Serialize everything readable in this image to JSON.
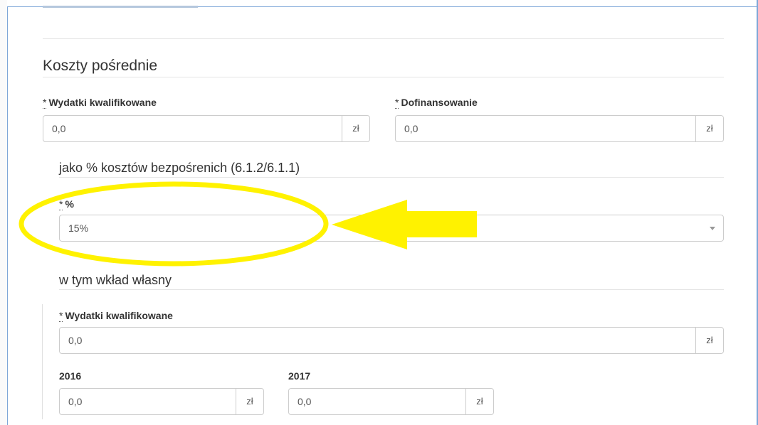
{
  "section": {
    "title": "Koszty pośrednie"
  },
  "required_marker": "*",
  "currency_unit": "zł",
  "eligible_costs": {
    "label": "Wydatki kwalifikowane",
    "value": "0,0"
  },
  "cofinancing": {
    "label": "Dofinansowanie",
    "value": "0,0"
  },
  "percent_section": {
    "title": "jako % kosztów bezpośrenich (6.1.2/6.1.1)",
    "percent_label": "%",
    "percent_value": "15%"
  },
  "own_contribution": {
    "title": "w tym wkład własny",
    "eligible_label": "Wydatki kwalifikowane",
    "eligible_value": "0,0",
    "year_2016_label": "2016",
    "year_2016_value": "0,0",
    "year_2017_label": "2017",
    "year_2017_value": "0,0"
  },
  "colors": {
    "annotation": "#fff200",
    "frame": "#7ea7d8"
  },
  "annotation": {
    "shapes": [
      "highlight-ellipse",
      "arrow-left"
    ]
  }
}
